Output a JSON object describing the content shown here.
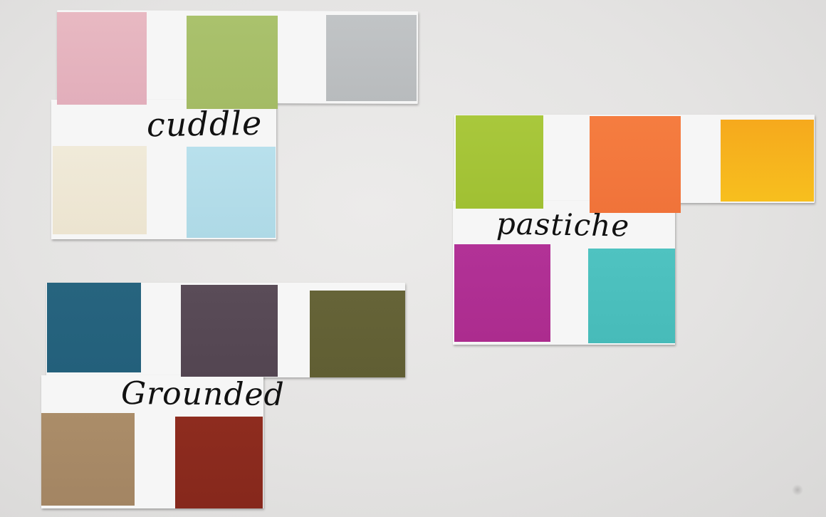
{
  "labels": {
    "cuddle": "cuddle",
    "pastiche": "pastiche",
    "grounded": "Grounded"
  },
  "palettes": {
    "cuddle": {
      "colors": [
        "#e6b6bf",
        "#a7bf6b",
        "#bcbfc1",
        "#efe9d8",
        "#b3dde9"
      ]
    },
    "pastiche": {
      "colors": [
        "#a6c63a",
        "#f47a3e",
        "#f6b21b",
        "#b02f93",
        "#4cc0be"
      ]
    },
    "grounded": {
      "colors": [
        "#27627d",
        "#574955",
        "#646237",
        "#a98b67",
        "#8b2a1e"
      ]
    }
  }
}
